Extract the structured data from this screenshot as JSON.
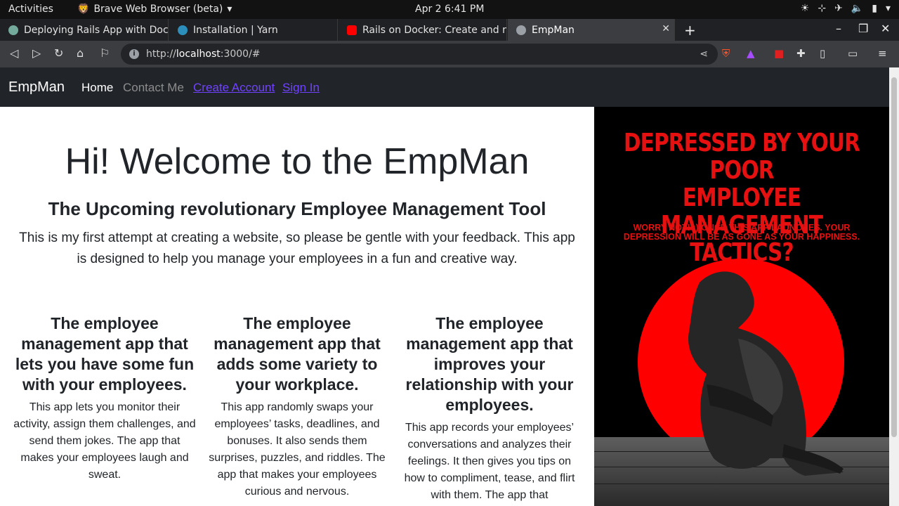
{
  "system": {
    "activities": "Activities",
    "app_name": "Brave Web Browser (beta)",
    "clock": "Apr 2  6:41 PM"
  },
  "tabs": [
    {
      "title": "Deploying Rails App with Doc",
      "icon_color": "#74aa9c"
    },
    {
      "title": "Installation | Yarn",
      "icon_color": "#2c8ebb"
    },
    {
      "title": "Rails on Docker: Create and ru",
      "icon_color": "#ff0000"
    },
    {
      "title": "EmpMan",
      "icon_color": "#9aa0a6"
    }
  ],
  "address": {
    "url_prefix": "http://",
    "url_host": "localhost",
    "url_rest": ":3000/#"
  },
  "site": {
    "brand": "EmpMan",
    "nav": {
      "home": "Home",
      "contact": "Contact Me",
      "create_account": "Create Account",
      "sign_in": "Sign In"
    },
    "hero": {
      "title": "Hi! Welcome to the EmpMan",
      "subtitle": "The Upcoming revolutionary Employee Management Tool",
      "lead": "This is my first attempt at creating a website, so please be gentle with your feedback. This app is designed to help you manage your employees in a fun and creative way."
    },
    "features": [
      {
        "heading": "The employee management app that lets you have some fun with your employees.",
        "body": "This app lets you monitor their activity, assign them challenges, and send them jokes. The app that makes your employees laugh and sweat."
      },
      {
        "heading": "The employee management app that adds some variety to your workplace.",
        "body": "This app randomly swaps your employees’ tasks, deadlines, and bonuses. It also sends them surprises, puzzles, and riddles. The app that makes your employees curious and nervous."
      },
      {
        "heading": "The employee management app that improves your relationship with your employees.",
        "body": "This app records your employees’ conversations and analyzes their feelings. It then gives you tips on how to compliment, tease, and flirt with them. The app that"
      }
    ],
    "poster": {
      "headline_1": "DEPRESSED BY YOUR POOR",
      "headline_2": "EMPLOYEE MANAGEMENT",
      "headline_3": "TACTICS?",
      "subline": "WORRY NOT! :) ONCE THIS APP LAUNCHES. YOUR DEPRESSION WILL BE AS GONE AS YOUR HAPPINESS."
    }
  },
  "colors": {
    "navbar": "#212529",
    "link": "#0d6efd",
    "poster_red": "#ff0000"
  }
}
